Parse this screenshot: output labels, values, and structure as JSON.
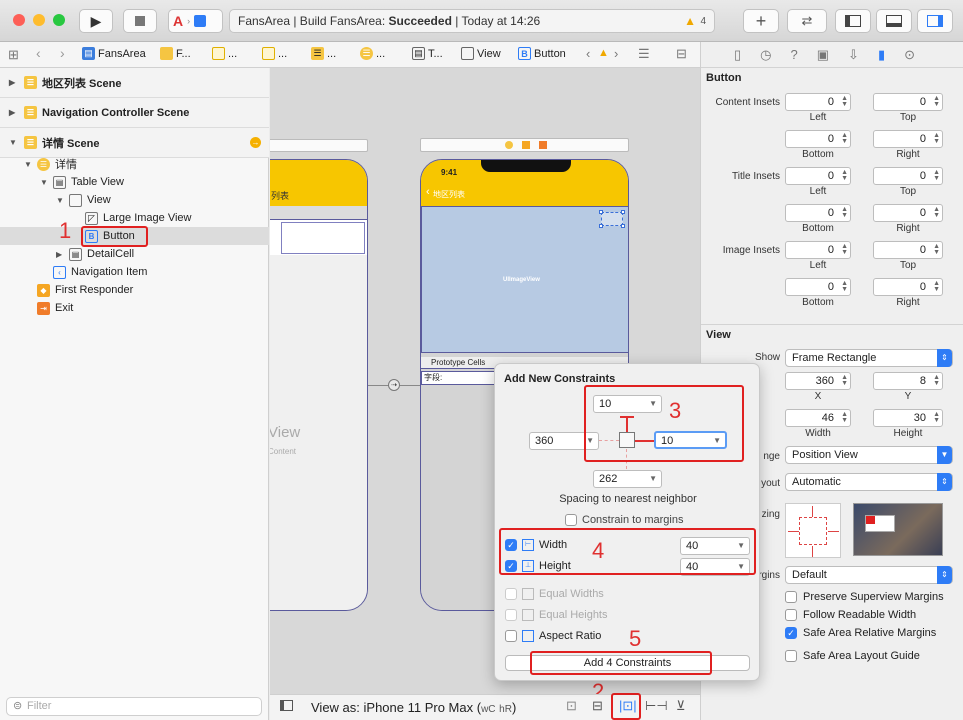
{
  "toolbar": {
    "scheme": "FansArea",
    "status_prefix": "FansArea | Build FansArea: ",
    "status_result": "Succeeded",
    "status_time": " | Today at 14:26",
    "warning_count": "4"
  },
  "jumpbar": {
    "items": [
      "FansArea",
      "F...",
      "...",
      "...",
      "...",
      "T...",
      "View",
      "Button"
    ]
  },
  "navigator": {
    "scenes": [
      "地区列表 Scene",
      "Navigation Controller Scene",
      "详情 Scene"
    ],
    "tree": {
      "root": "详情",
      "table_view": "Table View",
      "view": "View",
      "large_image_view": "Large Image View",
      "button": "Button",
      "detail_cell": "DetailCell",
      "navigation_item": "Navigation Item",
      "first_responder": "First Responder",
      "exit": "Exit"
    },
    "filter_placeholder": "Filter"
  },
  "canvas": {
    "left_title": "列表",
    "left_view": "View",
    "left_content": "Content",
    "time": "9:41",
    "back": "地区列表",
    "image_label": "UIImageView",
    "prototype": "Prototype Cells",
    "field_label": "字段",
    "bottom": {
      "view_as": "View as: iPhone 11 Pro Max (",
      "wc": "wC",
      "hr": "hR",
      "close": ")"
    }
  },
  "inspector": {
    "section_button": "Button",
    "content_insets": "Content Insets",
    "title_insets": "Title Insets",
    "image_insets": "Image Insets",
    "inset_values": [
      "0",
      "0",
      "0",
      "0"
    ],
    "sub_left": "Left",
    "sub_top": "Top",
    "sub_bottom": "Bottom",
    "sub_right": "Right",
    "section_view": "View",
    "show_label": "Show",
    "show_value": "Frame Rectangle",
    "x": "360",
    "y": "8",
    "x_label": "X",
    "y_label": "Y",
    "width": "46",
    "height": "30",
    "width_label": "Width",
    "height_label": "Height",
    "arrange_label": "nge",
    "arrange_value": "Position View",
    "layout_label": "yout",
    "layout_value": "Automatic",
    "sizing_label": "zing",
    "margins_label": "rgins",
    "margins_value": "Default",
    "checks": [
      {
        "label": "Preserve Superview Margins",
        "checked": false
      },
      {
        "label": "Follow Readable Width",
        "checked": false
      },
      {
        "label": "Safe Area Relative Margins",
        "checked": true
      },
      {
        "label": "Safe Area Layout Guide",
        "checked": false
      }
    ]
  },
  "popover": {
    "title": "Add New Constraints",
    "top": "10",
    "left": "360",
    "right": "10",
    "bottom": "262",
    "spacing_text": "Spacing to nearest neighbor",
    "constrain_margins": "Constrain to margins",
    "width_label": "Width",
    "width_value": "40",
    "height_label": "Height",
    "height_value": "40",
    "equal_widths": "Equal Widths",
    "equal_heights": "Equal Heights",
    "aspect_ratio": "Aspect Ratio",
    "add_button": "Add 4 Constraints"
  },
  "annotations": [
    "1",
    "2",
    "3",
    "4",
    "5"
  ],
  "colors": {
    "accent": "#2e7cf6",
    "annotation": "#e02020",
    "navbar": "#f7c600"
  }
}
